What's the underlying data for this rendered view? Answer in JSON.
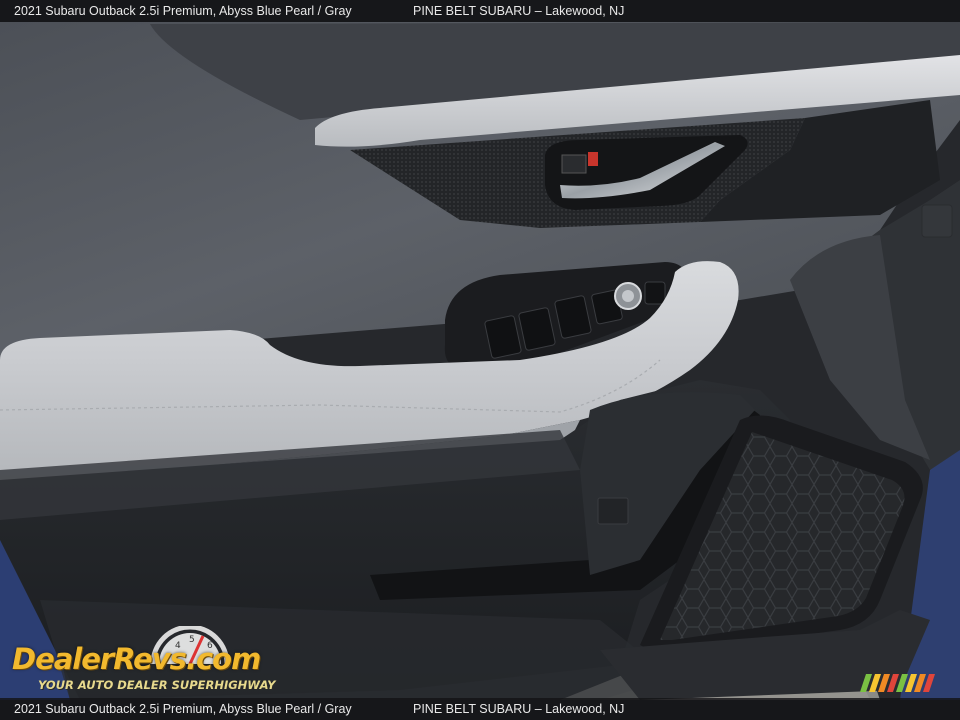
{
  "caption": {
    "vehicle": "2021 Subaru Outback 2.5i Premium,  Abyss Blue Pearl / Gray",
    "dealer": "PINE BELT SUBARU – Lakewood, NJ"
  },
  "watermark": {
    "name": "DealerRevs.com",
    "tagline": "YOUR AUTO DEALER SUPERHIGHWAY",
    "stripe_colors": [
      "#7ac143",
      "#f7c531",
      "#f08a24",
      "#e0453b"
    ]
  },
  "scene": {
    "subject": "front door interior panel",
    "colors": {
      "panel": "#5b5f66",
      "trim": "#cfd1d4",
      "dark_trim": "#1d1f22",
      "exterior_blue": "#2c3e73"
    }
  }
}
